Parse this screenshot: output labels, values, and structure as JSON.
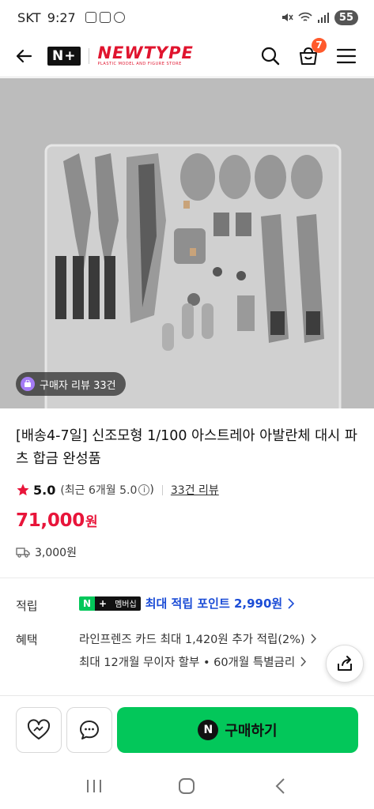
{
  "status_bar": {
    "carrier": "SKT",
    "time": "9:27",
    "battery": "55"
  },
  "header": {
    "nplus_label": "N+",
    "brand_name": "NEWTYPE",
    "brand_subtitle": "PLASTIC MODEL AND FIGURE STORE",
    "cart_count": "7"
  },
  "gallery": {
    "review_pill": "구매자 리뷰 33건"
  },
  "product": {
    "title": "[배송4-7일] 신조모형 1/100 아스트레아 아발란체 대시 파츠 합금 완성품",
    "rating": "5.0",
    "rating_recent": "(최근 6개월 5.0",
    "info_symbol": "i",
    "rating_recent_close": ")",
    "review_count_link": "33건 리뷰",
    "price": "71,000",
    "price_unit": "원",
    "shipping_fee": "3,000원"
  },
  "benefits": {
    "points_label": "적립",
    "membership_n": "N",
    "membership_plus": "+",
    "membership_tag": "멤버십",
    "points_text": "최대 적립 포인트 2,990원",
    "benefits_label": "혜택",
    "line1": "라인프렌즈 카드 최대 1,420원 추가 적립(2%)",
    "line2": "최대 12개월 무이자 할부 • 60개월 특별금리"
  },
  "bottom": {
    "buy_icon": "N",
    "buy_label": "구매하기"
  },
  "colors": {
    "brand_red": "#e0142e",
    "price_red": "#e8153a",
    "naver_green": "#03c75a",
    "point_blue": "#1b4cd6",
    "badge_orange": "#ff5a2c"
  }
}
